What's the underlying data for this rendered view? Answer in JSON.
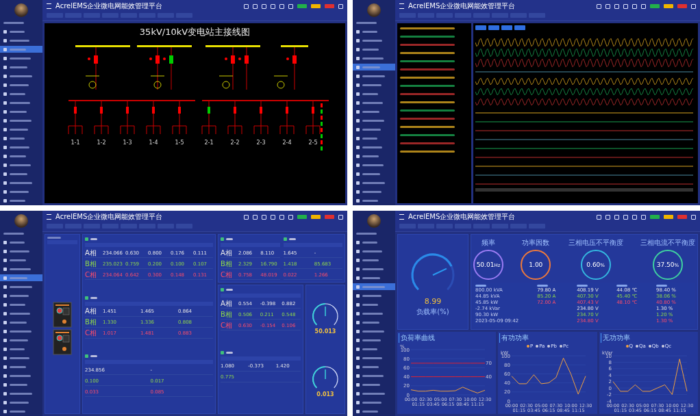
{
  "screens": [
    {
      "kind": "diagram",
      "title": "AcrelEMS企业微电网能效管理平台",
      "menu": [
        {
          "selected": false
        },
        {
          "selected": false
        },
        {
          "selected": true
        },
        {
          "selected": false
        },
        {
          "selected": false
        },
        {
          "selected": false
        }
      ],
      "diagram_title": "35kV/10kV变电站主接线图",
      "bays": [
        "1-1",
        "1-2",
        "1-3",
        "1-4",
        "1-5",
        "2-1",
        "2-2",
        "2-3",
        "2-4",
        "2-5"
      ]
    },
    {
      "kind": "waveform",
      "title": "AcrelEMS企业微电网能效管理平台",
      "menu": [
        {
          "selected": false
        },
        {
          "selected": false
        },
        {
          "selected": false
        },
        {
          "selected": false
        },
        {
          "selected": true
        },
        {
          "selected": false
        }
      ]
    },
    {
      "kind": "meter",
      "title": "AcrelEMS企业微电网能效管理平台",
      "menu": [
        {
          "selected": false
        },
        {
          "selected": false
        },
        {
          "selected": false
        },
        {
          "selected": false
        },
        {
          "selected": true
        },
        {
          "selected": false
        }
      ],
      "voltage_panel": {
        "tables": [
          {
            "rows": [
              {
                "phase": "A相",
                "values": [
                  "234.066",
                  "0.630",
                  "0.800",
                  "0.176",
                  "0.111"
                ]
              },
              {
                "phase": "B相",
                "values": [
                  "235.023",
                  "0.759",
                  "0.200",
                  "0.100",
                  "0.107"
                ]
              },
              {
                "phase": "C相",
                "values": [
                  "234.064",
                  "0.642",
                  "0.300",
                  "0.148",
                  "0.131"
                ]
              }
            ]
          },
          {
            "rows": [
              {
                "phase": "A相",
                "values": [
                  "1.451",
                  "1.465",
                  "0.864"
                ]
              },
              {
                "phase": "B相",
                "values": [
                  "1.330",
                  "1.336",
                  "0.808"
                ]
              },
              {
                "phase": "C相",
                "values": [
                  "1.017",
                  "1.481",
                  "0.883"
                ]
              }
            ]
          },
          {
            "rows": [
              {
                "values": [
                  "234.856",
                  "-"
                ]
              },
              {
                "values": [
                  "0.100",
                  "0.017"
                ]
              },
              {
                "values": [
                  "0.033",
                  "0.085"
                ]
              }
            ]
          }
        ]
      },
      "current_panel": {
        "tables": [
          {
            "rows": [
              {
                "phase": "A相",
                "values": [
                  "2.086",
                  "8.110"
                ]
              },
              {
                "phase": "B相",
                "values": [
                  "2.329",
                  "16.790"
                ]
              },
              {
                "phase": "C相",
                "values": [
                  "0.758",
                  "48.019"
                ]
              }
            ]
          },
          {
            "rows": [
              {
                "values": [
                  "1.645",
                  "-"
                ]
              },
              {
                "values": [
                  "1.418",
                  "85.683"
                ]
              },
              {
                "values": [
                  "0.022",
                  "1.266"
                ]
              }
            ]
          }
        ]
      },
      "power_panel": {
        "tables": [
          {
            "rows": [
              {
                "phase": "A相",
                "values": [
                  "0.554",
                  "-0.398",
                  "0.882"
                ]
              },
              {
                "phase": "B相",
                "values": [
                  "0.506",
                  "0.211",
                  "0.548"
                ]
              },
              {
                "phase": "C相",
                "values": [
                  "0.630",
                  "-0.154",
                  "0.106"
                ]
              }
            ]
          },
          {
            "rows": [
              {
                "values": [
                  "1.080",
                  "-0.373",
                  "1.420"
                ]
              },
              {
                "values": [
                  "0.775"
                ]
              }
            ]
          }
        ]
      },
      "gauges": [
        {
          "value": "50.013",
          "level": 0.5
        },
        {
          "value": "0.013",
          "level": 0.5
        }
      ]
    },
    {
      "kind": "dashboard",
      "title": "AcrelEMS企业微电网能效管理平台",
      "menu": [
        {
          "selected": false
        },
        {
          "selected": false
        },
        {
          "selected": false
        },
        {
          "selected": false
        },
        {
          "selected": false
        },
        {
          "selected": true
        }
      ],
      "main_gauge": {
        "value": "8.99",
        "label": "负载率(%)",
        "level": 0.74
      },
      "rings": [
        {
          "label": "频率",
          "value": "50.01",
          "unit": "Hz",
          "color": "#9b7cf4"
        },
        {
          "label": "功率因数",
          "value": "1.00",
          "color": "#f07a3a"
        },
        {
          "label": "三相电压不平衡度",
          "value": "0.60",
          "unit": "%",
          "color": "#34b8e0"
        },
        {
          "label": "三相电流不平衡度",
          "value": "37.50",
          "unit": "%",
          "color": "#3fd1a0"
        }
      ],
      "info_columns": [
        [
          "800.00 kVA",
          "44.85 kVA",
          "45.85 kW",
          "-2.74 kVar",
          "90.30 kW",
          "2023-05-09 09:42"
        ],
        [
          "79.80 A",
          "85.20 A",
          "72.00 A"
        ],
        [
          "408.19 V",
          "407.30 V",
          "407.43 V",
          "234.80 V",
          "234.70 V",
          "234.80 V"
        ],
        [
          "44.08 ℃",
          "45.40 ℃",
          "48.10 ℃"
        ],
        [
          "98.40 %",
          "38.06 %",
          "40.80 %",
          "1.30 %",
          "1.20 %",
          "1.30 %"
        ]
      ],
      "charts": [
        {
          "chart_data": {
            "type": "line",
            "title": "负荷率曲线",
            "ylabel": "%",
            "categories": [
              "00:00",
              "01:15",
              "02:30",
              "03:45",
              "05:00",
              "06:15",
              "07:30",
              "08:45",
              "10:00",
              "11:15",
              "12:30"
            ],
            "ylim": [
              0,
              100
            ],
            "yticks": [
              0,
              20,
              40,
              60,
              80,
              100
            ],
            "grid": true,
            "series": [
              {
                "color": "#f0a040",
                "values": [
                  11,
                  8,
                  8,
                  10,
                  8,
                  8,
                  9,
                  17,
                  10,
                  4,
                  10
                ]
              },
              {
                "color": "#e02030",
                "values": [
                  70,
                  70,
                  70,
                  70,
                  70,
                  70,
                  70,
                  70,
                  70,
                  70,
                  70
                ]
              },
              {
                "color": "#e02030",
                "values": [
                  40,
                  40,
                  40,
                  40,
                  40,
                  40,
                  40,
                  40,
                  40,
                  40,
                  40
                ]
              }
            ],
            "annotations": [
              {
                "text": "70",
                "x": "12:30",
                "y": 70
              },
              {
                "text": "40",
                "x": "12:30",
                "y": 40
              }
            ]
          }
        },
        {
          "legend": [
            "Pa",
            "Pb",
            "Pc"
          ],
          "chart_data": {
            "type": "line",
            "title": "有功功率",
            "ylabel": "kW",
            "categories": [
              "00:00",
              "01:15",
              "02:30",
              "03:45",
              "05:00",
              "06:15",
              "07:30",
              "08:45",
              "10:00",
              "11:15",
              "12:30"
            ],
            "ylim": [
              0,
              100
            ],
            "yticks": [
              0,
              20,
              40,
              60,
              80,
              100
            ],
            "grid": true,
            "series": [
              {
                "name": "P",
                "color": "#f0a040",
                "values": [
                  55,
                  38,
                  38,
                  58,
                  38,
                  40,
                  52,
                  95,
                  60,
                  15,
                  55
                ]
              }
            ]
          }
        },
        {
          "legend": [
            "Qa",
            "Qb",
            "Qc"
          ],
          "chart_data": {
            "type": "line",
            "title": "无功功率",
            "ylabel": "kVar",
            "categories": [
              "00:00",
              "01:15",
              "02:30",
              "03:45",
              "05:00",
              "06:15",
              "07:30",
              "08:45",
              "10:00",
              "11:15",
              "12:30"
            ],
            "ylim": [
              -4,
              10
            ],
            "yticks": [
              -4,
              -2,
              0,
              2,
              4,
              6,
              8,
              10
            ],
            "grid": true,
            "series": [
              {
                "name": "Q",
                "color": "#f0a040",
                "values": [
                  2,
                  -1,
                  -1,
                  1,
                  -1,
                  -1,
                  0,
                  1,
                  -2,
                  9,
                  -1
                ]
              }
            ]
          }
        }
      ]
    }
  ]
}
